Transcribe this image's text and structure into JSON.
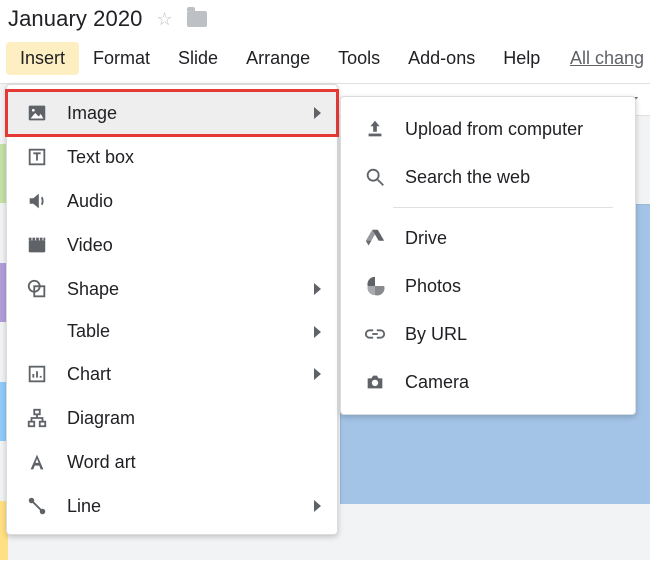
{
  "title": "January 2020",
  "menubar": {
    "items": [
      {
        "label": "Insert",
        "active": true
      },
      {
        "label": "Format"
      },
      {
        "label": "Slide"
      },
      {
        "label": "Arrange"
      },
      {
        "label": "Tools"
      },
      {
        "label": "Add-ons"
      },
      {
        "label": "Help"
      }
    ],
    "status": "All chang"
  },
  "insert_menu": {
    "image": {
      "label": "Image",
      "has_submenu": true
    },
    "textbox": {
      "label": "Text box"
    },
    "audio": {
      "label": "Audio"
    },
    "video": {
      "label": "Video"
    },
    "shape": {
      "label": "Shape",
      "has_submenu": true
    },
    "table": {
      "label": "Table",
      "has_submenu": true
    },
    "chart": {
      "label": "Chart",
      "has_submenu": true
    },
    "diagram": {
      "label": "Diagram"
    },
    "wordart": {
      "label": "Word art"
    },
    "line": {
      "label": "Line",
      "has_submenu": true
    }
  },
  "image_submenu": {
    "upload": {
      "label": "Upload from computer"
    },
    "search": {
      "label": "Search the web"
    },
    "drive": {
      "label": "Drive"
    },
    "photos": {
      "label": "Photos"
    },
    "url": {
      "label": "By URL"
    },
    "camera": {
      "label": "Camera"
    }
  },
  "colors": {
    "highlight_red": "#e53935",
    "active_menu_bg": "#feefc3"
  }
}
